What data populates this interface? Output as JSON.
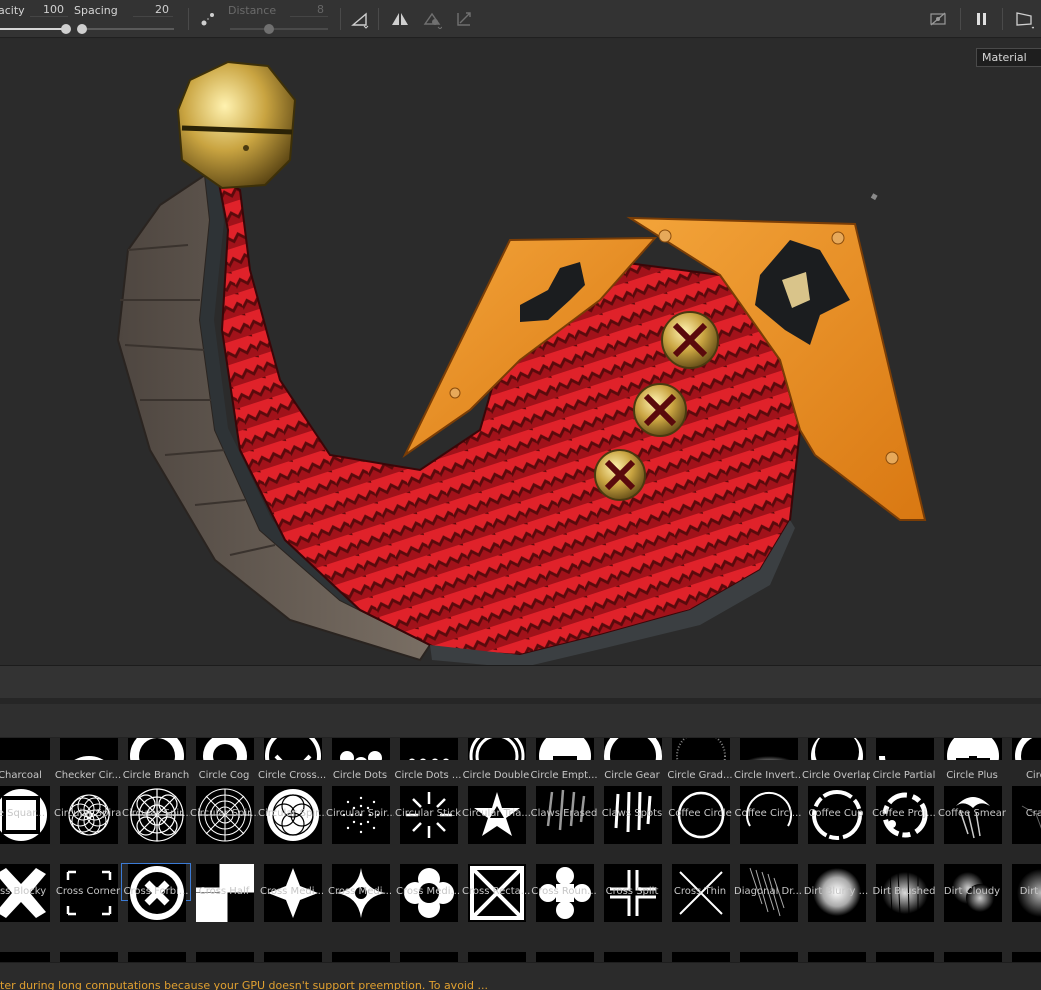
{
  "toolbar": {
    "opacity_label": "acity",
    "opacity_value": "100",
    "opacity_level": 1.0,
    "spacing_label": "Spacing",
    "spacing_value": "20",
    "spacing_level": 0.04,
    "distance_label": "Distance",
    "distance_value": "8",
    "distance_level": 0.4
  },
  "viewport": {
    "channel_select": "Material"
  },
  "shelf": {
    "rows": [
      {
        "items": [
          {
            "label": "Charcoal",
            "icon": "charcoal"
          },
          {
            "label": "Checker Cir...",
            "icon": "checker-circle"
          },
          {
            "label": "Circle Branch",
            "icon": "circle-branch"
          },
          {
            "label": "Circle Cog",
            "icon": "circle-cog"
          },
          {
            "label": "Circle Cross...",
            "icon": "circle-cross"
          },
          {
            "label": "Circle Dots",
            "icon": "circle-dots"
          },
          {
            "label": "Circle Dots ...",
            "icon": "circle-dots-2"
          },
          {
            "label": "Circle Double",
            "icon": "circle-double"
          },
          {
            "label": "Circle Empt...",
            "icon": "circle-empty"
          },
          {
            "label": "Circle Gear",
            "icon": "circle-gear"
          },
          {
            "label": "Circle Grad...",
            "icon": "circle-gradient"
          },
          {
            "label": "Circle Invert...",
            "icon": "circle-inverted"
          },
          {
            "label": "Circle Overlap",
            "icon": "circle-overlap"
          },
          {
            "label": "Circle Partial",
            "icon": "circle-partial"
          },
          {
            "label": "Circle Plus",
            "icon": "circle-plus"
          },
          {
            "label": "Circle",
            "icon": "circle"
          }
        ]
      },
      {
        "items": [
          {
            "label": "le Squar...",
            "icon": "circle-square"
          },
          {
            "label": "Circular Spiral",
            "icon": "circular-spiral"
          },
          {
            "label": "Circular Spir...",
            "icon": "circular-spiral-2"
          },
          {
            "label": "Circular Spir...",
            "icon": "circular-spiral-3"
          },
          {
            "label": "Circular Spir...",
            "icon": "circular-spiral-4"
          },
          {
            "label": "Circular Spir...",
            "icon": "circular-spiral-5"
          },
          {
            "label": "Circular Stick",
            "icon": "circular-stick"
          },
          {
            "label": "Circular Tria...",
            "icon": "circular-triangle"
          },
          {
            "label": "Claws Erased",
            "icon": "claws-erased"
          },
          {
            "label": "Claws Spots",
            "icon": "claws-spots"
          },
          {
            "label": "Coffee Circle",
            "icon": "coffee-circle"
          },
          {
            "label": "Coffee Circl...",
            "icon": "coffee-circle-2"
          },
          {
            "label": "Coffee Cup",
            "icon": "coffee-cup"
          },
          {
            "label": "Coffee Proj...",
            "icon": "coffee-projection"
          },
          {
            "label": "Coffee Smear",
            "icon": "coffee-smear"
          },
          {
            "label": "Crack",
            "icon": "crack"
          }
        ]
      },
      {
        "items": [
          {
            "label": "oss Blocky",
            "icon": "cross-blocky"
          },
          {
            "label": "Cross Corner",
            "icon": "cross-corner"
          },
          {
            "label": "Cross Forbi...",
            "icon": "cross-forbidden"
          },
          {
            "label": "Cross Half",
            "icon": "cross-half"
          },
          {
            "label": "Cross Medi...",
            "icon": "cross-medieval"
          },
          {
            "label": "Cross Medi...",
            "icon": "cross-medieval-2"
          },
          {
            "label": "Cross Medi...",
            "icon": "cross-medieval-3"
          },
          {
            "label": "Cross Recta...",
            "icon": "cross-rectangle"
          },
          {
            "label": "Cross Roun...",
            "icon": "cross-round"
          },
          {
            "label": "Cross Split",
            "icon": "cross-split"
          },
          {
            "label": "Cross Thin",
            "icon": "cross-thin"
          },
          {
            "label": "Diagonal Dr...",
            "icon": "diagonal-drips"
          },
          {
            "label": "Dirt Blurry ...",
            "icon": "dirt-blurry"
          },
          {
            "label": "Dirt Brushed",
            "icon": "dirt-brushed"
          },
          {
            "label": "Dirt Cloudy",
            "icon": "dirt-cloudy"
          },
          {
            "label": "Dirt Smi",
            "icon": "dirt-smudge"
          }
        ]
      }
    ]
  },
  "status": {
    "message": "ter during long computations because your GPU doesn't support preemption. To avoid ..."
  }
}
